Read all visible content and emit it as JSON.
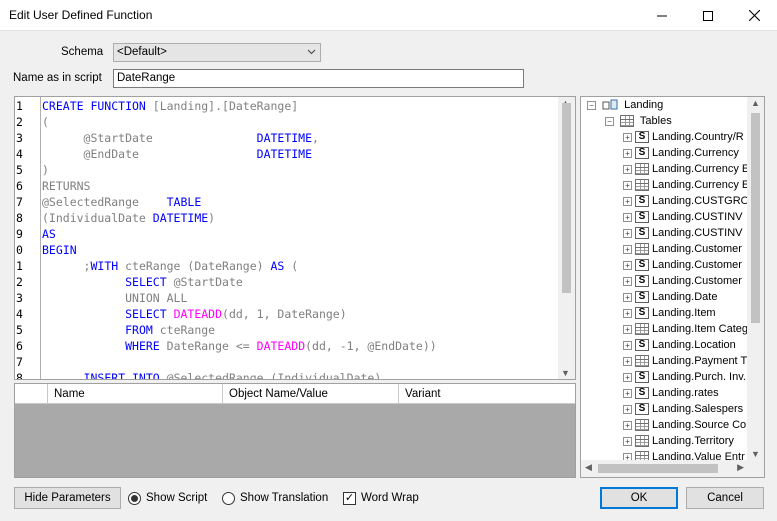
{
  "window": {
    "title": "Edit User Defined Function"
  },
  "form": {
    "schema_label": "Schema",
    "schema_value": "<Default>",
    "name_label": "Name as in script",
    "name_value": "DateRange"
  },
  "editor": {
    "line_numbers": [
      "1",
      "2",
      "3",
      "4",
      "5",
      "6",
      "7",
      "8",
      "9",
      "0",
      "1",
      "2",
      "3",
      "4",
      "5",
      "6",
      "7",
      "8"
    ],
    "lines": [
      [
        {
          "t": "CREATE FUNCTION ",
          "c": "kw"
        },
        {
          "t": "[Landing].[DateRange]",
          "c": "gr"
        }
      ],
      [
        {
          "t": "(",
          "c": "gr"
        }
      ],
      [
        {
          "t": "      @StartDate               ",
          "c": "gr"
        },
        {
          "t": "DATETIME",
          "c": "kw"
        },
        {
          "t": ",",
          "c": "gr"
        }
      ],
      [
        {
          "t": "      @EndDate                 ",
          "c": "gr"
        },
        {
          "t": "DATETIME",
          "c": "kw"
        }
      ],
      [
        {
          "t": ")",
          "c": "gr"
        }
      ],
      [
        {
          "t": "RETURNS",
          "c": "gr"
        }
      ],
      [
        {
          "t": "@SelectedRange    ",
          "c": "gr"
        },
        {
          "t": "TABLE",
          "c": "kw"
        }
      ],
      [
        {
          "t": "(IndividualDate ",
          "c": "gr"
        },
        {
          "t": "DATETIME",
          "c": "kw"
        },
        {
          "t": ")",
          "c": "gr"
        }
      ],
      [
        {
          "t": "AS",
          "c": "kw"
        }
      ],
      [
        {
          "t": "BEGIN",
          "c": "kw"
        }
      ],
      [
        {
          "t": "      ;",
          "c": "gr"
        },
        {
          "t": "WITH ",
          "c": "kw"
        },
        {
          "t": "cteRange (DateRange) ",
          "c": "gr"
        },
        {
          "t": "AS ",
          "c": "kw"
        },
        {
          "t": "(",
          "c": "gr"
        }
      ],
      [
        {
          "t": "            ",
          "c": "gr"
        },
        {
          "t": "SELECT ",
          "c": "kw"
        },
        {
          "t": "@StartDate",
          "c": "gr"
        }
      ],
      [
        {
          "t": "            ",
          "c": "gr"
        },
        {
          "t": "UNION ALL",
          "c": "gr"
        }
      ],
      [
        {
          "t": "            ",
          "c": "gr"
        },
        {
          "t": "SELECT ",
          "c": "kw"
        },
        {
          "t": "DATEADD",
          "c": "fn"
        },
        {
          "t": "(dd, 1, DateRange)",
          "c": "gr"
        }
      ],
      [
        {
          "t": "            ",
          "c": "gr"
        },
        {
          "t": "FROM ",
          "c": "kw"
        },
        {
          "t": "cteRange",
          "c": "gr"
        }
      ],
      [
        {
          "t": "            ",
          "c": "gr"
        },
        {
          "t": "WHERE ",
          "c": "kw"
        },
        {
          "t": "DateRange <= ",
          "c": "gr"
        },
        {
          "t": "DATEADD",
          "c": "fn"
        },
        {
          "t": "(dd, -1, @EndDate))",
          "c": "gr"
        }
      ],
      [
        {
          "t": "",
          "c": "gr"
        }
      ],
      [
        {
          "t": "      ",
          "c": "gr"
        },
        {
          "t": "INSERT INTO ",
          "c": "kw"
        },
        {
          "t": "@SelectedRange (IndividualDate)",
          "c": "gr"
        }
      ]
    ]
  },
  "params_grid": {
    "columns": [
      "Name",
      "Object Name/Value",
      "Variant"
    ]
  },
  "tree": {
    "root": "Landing",
    "folder": "Tables",
    "items": [
      {
        "label": "Landing.Country/R",
        "icon": "synonym-icon"
      },
      {
        "label": "Landing.Currency",
        "icon": "synonym-icon"
      },
      {
        "label": "Landing.Currency E",
        "icon": "table-icon"
      },
      {
        "label": "Landing.Currency E",
        "icon": "table-icon"
      },
      {
        "label": "Landing.CUSTGRO",
        "icon": "synonym-icon"
      },
      {
        "label": "Landing.CUSTINV",
        "icon": "synonym-icon"
      },
      {
        "label": "Landing.CUSTINV",
        "icon": "synonym-icon"
      },
      {
        "label": "Landing.Customer",
        "icon": "table-icon"
      },
      {
        "label": "Landing.Customer",
        "icon": "synonym-icon"
      },
      {
        "label": "Landing.Customer",
        "icon": "synonym-icon"
      },
      {
        "label": "Landing.Date",
        "icon": "synonym-clock-icon"
      },
      {
        "label": "Landing.Item",
        "icon": "synonym-icon"
      },
      {
        "label": "Landing.Item Categ",
        "icon": "table-icon"
      },
      {
        "label": "Landing.Location",
        "icon": "synonym-icon"
      },
      {
        "label": "Landing.Payment T",
        "icon": "table-icon"
      },
      {
        "label": "Landing.Purch. Inv.",
        "icon": "synonym-icon"
      },
      {
        "label": "Landing.rates",
        "icon": "synonym-icon"
      },
      {
        "label": "Landing.Salespers",
        "icon": "synonym-icon"
      },
      {
        "label": "Landing.Source Co",
        "icon": "table-icon"
      },
      {
        "label": "Landing.Territory",
        "icon": "table-icon"
      },
      {
        "label": "Landing.Value Entr",
        "icon": "table-icon"
      }
    ]
  },
  "footer": {
    "hide_params": "Hide Parameters",
    "show_script": "Show Script",
    "show_translation": "Show Translation",
    "word_wrap": "Word Wrap",
    "ok": "OK",
    "cancel": "Cancel",
    "show_script_selected": true,
    "word_wrap_checked": true
  },
  "colors": {
    "keyword": "#0000ff",
    "function": "#ff00ff",
    "text": "#808080",
    "default_button_border": "#0078d7"
  }
}
